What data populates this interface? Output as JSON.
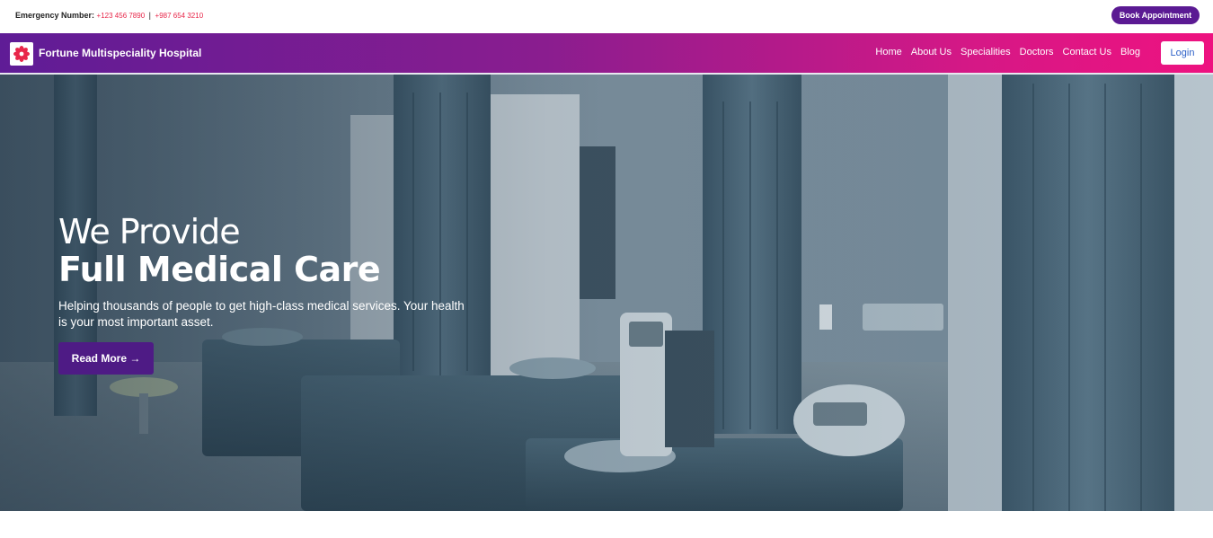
{
  "topbar": {
    "emergency_label": "Emergency Number:",
    "phone_1": "+123 456 7890",
    "separator": "|",
    "phone_2": "+987 654 3210",
    "book_button": "Book Appointment"
  },
  "navbar": {
    "logo_icon": "flower-logo-icon",
    "brand": "Fortune Multispeciality Hospital",
    "links": [
      "Home",
      "About Us",
      "Specialities",
      "Doctors",
      "Contact Us",
      "Blog"
    ],
    "login_button": "Login"
  },
  "hero": {
    "subtitle": "We Provide",
    "title": "Full Medical Care",
    "description": "Helping thousands of people to get high-class medical services. Your health is your most important asset.",
    "cta_button": "Read More →"
  },
  "colors": {
    "brand_purple": "#5b1a93",
    "gradient_start": "#5f1c96",
    "gradient_end": "#ee1280",
    "phone_red": "#e8274a",
    "login_text": "#2b5fc7"
  }
}
